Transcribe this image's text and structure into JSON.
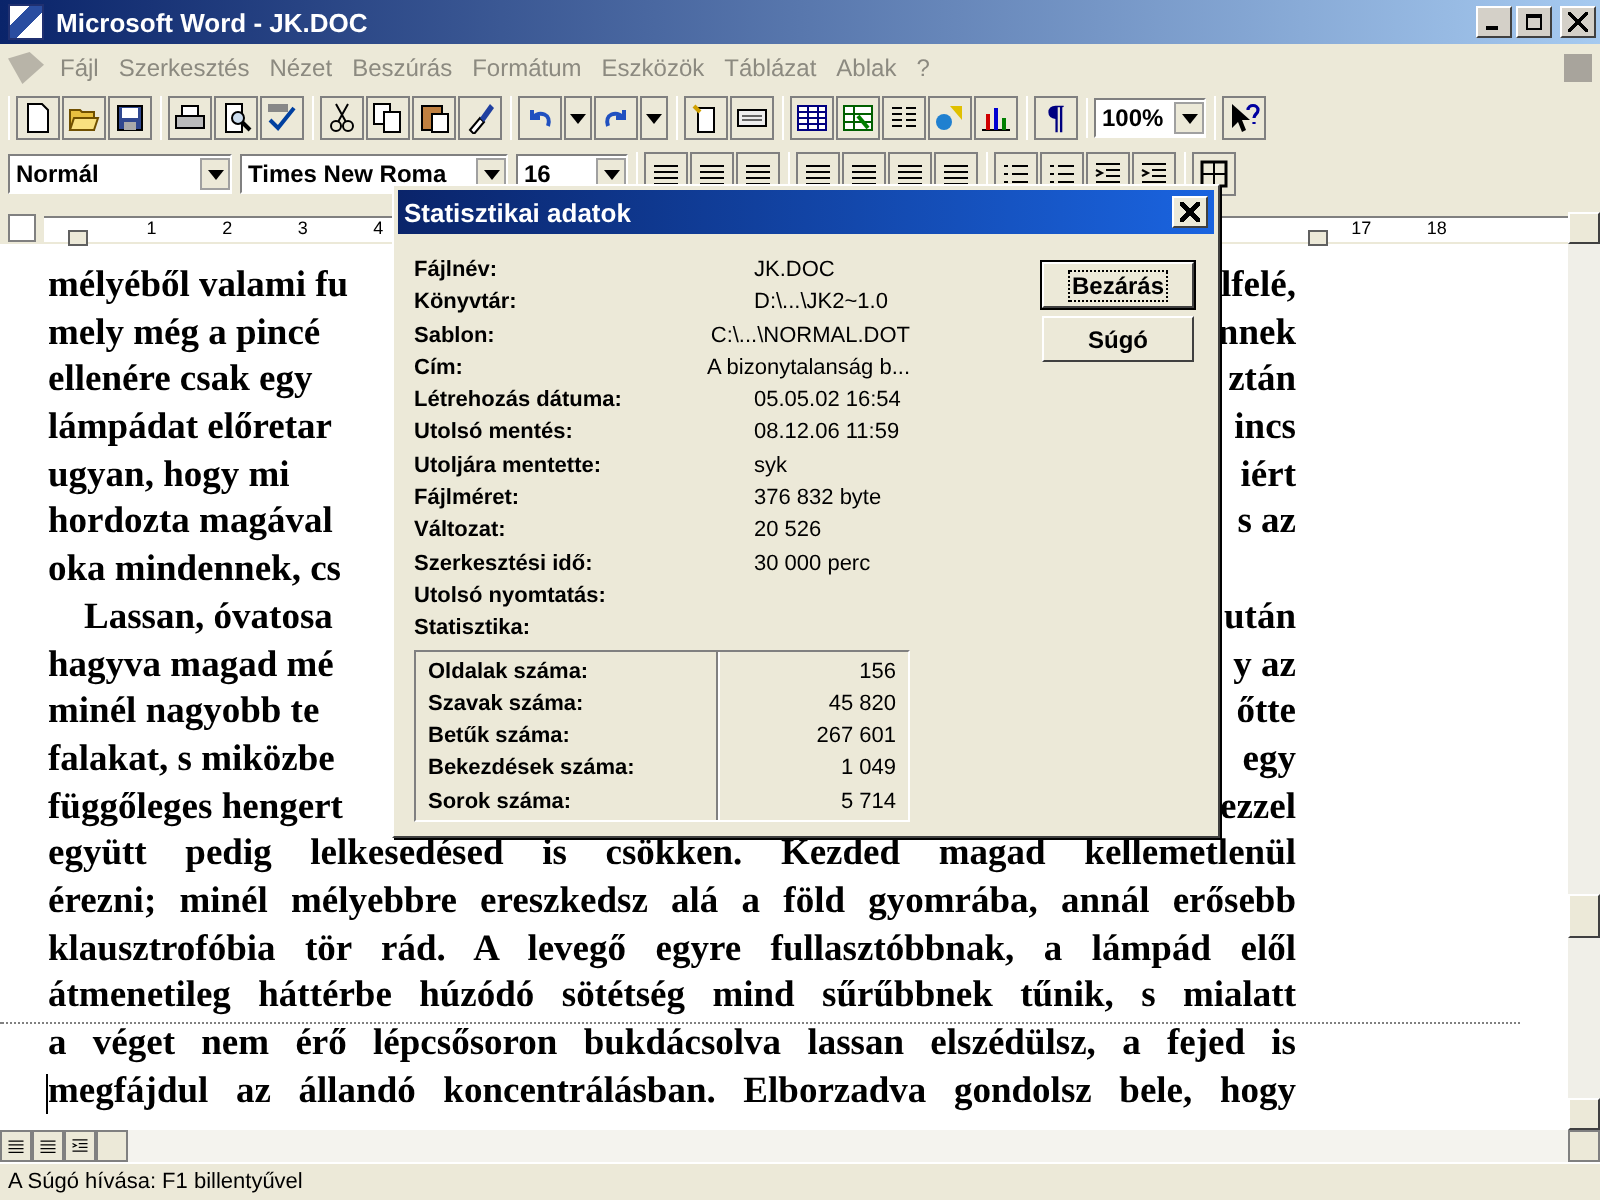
{
  "window": {
    "title": "Microsoft Word - JK.DOC"
  },
  "menu": [
    {
      "label": "Fájl",
      "disabled": true
    },
    {
      "label": "Szerkesztés",
      "disabled": true
    },
    {
      "label": "Nézet",
      "disabled": true
    },
    {
      "label": "Beszúrás",
      "disabled": true
    },
    {
      "label": "Formátum",
      "disabled": true
    },
    {
      "label": "Eszközök",
      "disabled": true
    },
    {
      "label": "Táblázat",
      "disabled": true
    },
    {
      "label": "Ablak",
      "disabled": true
    },
    {
      "label": "?",
      "disabled": true
    }
  ],
  "standard_toolbar": {
    "marks_button": "¶",
    "zoom": "100%"
  },
  "formatting_toolbar": {
    "style": "Normál",
    "font": "Times New Roma",
    "size": "16"
  },
  "ruler": {
    "left_numbers": [
      "1",
      "2",
      "3",
      "4"
    ],
    "right_numbers": [
      "17",
      "18"
    ]
  },
  "document": {
    "lines": [
      {
        "left": "mélyéből valami fu",
        "right": "lfelé,",
        "indent": false,
        "page_break_before": false,
        "caret": false
      },
      {
        "left": "mely még a pincé",
        "right": "nnek",
        "indent": false,
        "page_break_before": false,
        "caret": false
      },
      {
        "left": "ellenére csak egy",
        "right": "ztán",
        "indent": false,
        "page_break_before": false,
        "caret": false
      },
      {
        "left": "lámpádat előretar",
        "right": "incs",
        "indent": false,
        "page_break_before": false,
        "caret": false
      },
      {
        "left": "ugyan, hogy mi",
        "right": "iért",
        "indent": false,
        "page_break_before": false,
        "caret": false
      },
      {
        "left": "hordozta magával",
        "right": "s az",
        "indent": false,
        "page_break_before": false,
        "caret": false
      },
      {
        "left": "oka mindennek, cs",
        "indent": false,
        "page_break_before": false,
        "caret": false
      },
      {
        "left": "Lassan, óvatosa",
        "right": "után",
        "indent": true,
        "page_break_before": false,
        "caret": false
      },
      {
        "left": "hagyva magad mé",
        "right": "y az",
        "indent": false,
        "page_break_before": false,
        "caret": false
      },
      {
        "left": "minél nagyobb te",
        "right": "őtte",
        "indent": false,
        "page_break_before": false,
        "caret": false
      },
      {
        "left": "falakat, s miközbe",
        "right": "egy",
        "indent": false,
        "page_break_before": false,
        "caret": false
      },
      {
        "left": "függőleges hengert",
        "right": "ezzel",
        "indent": false,
        "page_break_before": false,
        "caret": false
      },
      {
        "text": "együtt pedig lelkesedésed is csökken. Kezded magad kellemetlenül",
        "indent": false,
        "page_break_before": false,
        "caret": false
      },
      {
        "text": "érezni; minél mélyebbre ereszkedsz alá a föld gyomrába, annál erősebb",
        "indent": false,
        "page_break_before": false,
        "caret": false
      },
      {
        "text": "klausztrofóbia tör rád. A levegő egyre fullasztóbbnak, a lámpád elől",
        "indent": false,
        "page_break_before": false,
        "caret": false
      },
      {
        "text": "átmenetileg háttérbe húzódó sötétség mind sűrűbbnek tűnik, s mialatt",
        "indent": false,
        "page_break_before": false,
        "caret": false
      },
      {
        "text": "a véget nem érő lépcsősoron bukdácsolva lassan elszédülsz, a fejed is",
        "indent": false,
        "page_break_before": true,
        "caret": false
      },
      {
        "text": "megfájdul az állandó koncentrálásban. Elborzadva gondolsz bele, hogy",
        "indent": false,
        "page_break_before": false,
        "caret": true
      }
    ]
  },
  "dialog": {
    "title": "Statisztikai adatok",
    "fields": [
      {
        "label": "Fájlnév:",
        "value": "JK.DOC"
      },
      {
        "label": "Könyvtár:",
        "value": "D:\\...\\JK2~1.0"
      },
      {
        "label": "Sablon:",
        "value": "C:\\...\\NORMAL.DOT"
      },
      {
        "label": "Cím:",
        "value": "A bizonytalanság b..."
      },
      {
        "label": "Létrehozás dátuma:",
        "value": "05.05.02 16:54"
      },
      {
        "label": "Utolsó mentés:",
        "value": "08.12.06 11:59"
      },
      {
        "label": "Utoljára mentette:",
        "value": "syk"
      },
      {
        "label": "Fájlméret:",
        "value": "376 832 byte"
      },
      {
        "label": "Változat:",
        "value": "20 526"
      },
      {
        "label": "Szerkesztési idő:",
        "value": "30 000 perc"
      },
      {
        "label": "Utolsó nyomtatás:"
      },
      {
        "label": "Statisztika:"
      }
    ],
    "statistics": [
      {
        "label": "Oldalak száma:",
        "value": "156"
      },
      {
        "label": "Szavak száma:",
        "value": "45 820"
      },
      {
        "label": "Betűk száma:",
        "value": "267 601"
      },
      {
        "label": "Bekezdések száma:",
        "value": "1 049"
      },
      {
        "label": "Sorok száma:",
        "value": "5 714"
      }
    ],
    "buttons": [
      {
        "label": "Bezárás",
        "selected": true
      },
      {
        "label": "Súgó",
        "selected": false
      }
    ]
  },
  "status_bar": {
    "text": "A Súgó hívása: F1 billentyűvel"
  }
}
